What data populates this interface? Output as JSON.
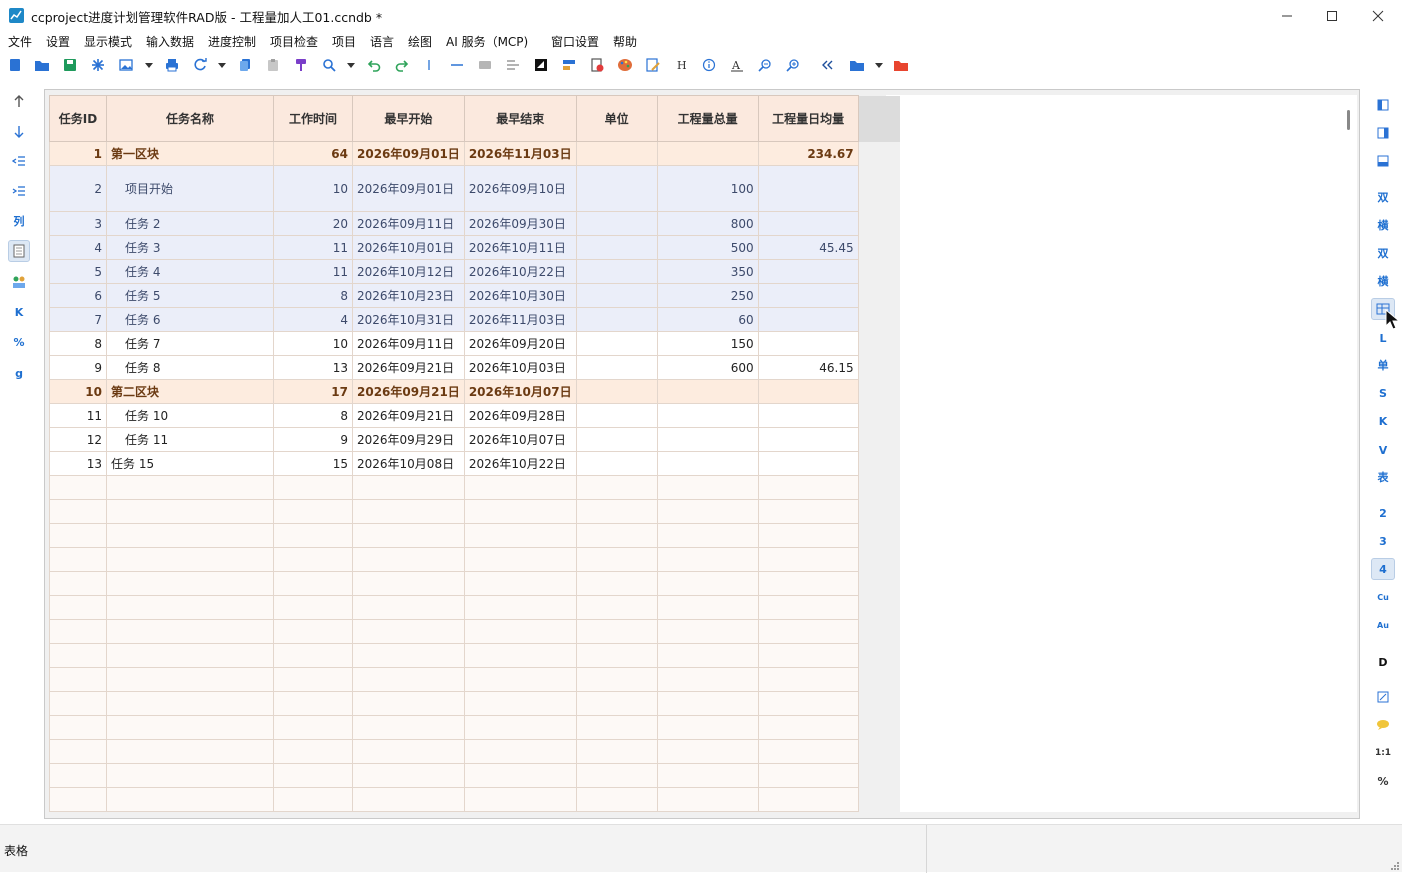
{
  "window": {
    "title": "ccproject进度计划管理软件RAD版 - 工程量加人工01.ccndb *"
  },
  "menu": [
    "文件",
    "设置",
    "显示模式",
    "输入数据",
    "进度控制",
    "项目检查",
    "项目",
    "语言",
    "绘图",
    "AI 服务（MCP)",
    "窗口设置",
    "帮助"
  ],
  "left_tools": {
    "col": "列",
    "k": "K",
    "percent": "%",
    "g": "g"
  },
  "right_tools": {
    "shuang": "双",
    "heng": "横",
    "shuang2": "双",
    "heng2": "横",
    "L": "L",
    "dan": "单",
    "S": "S",
    "K": "K",
    "V": "V",
    "biao": "表",
    "n2": "2",
    "n3": "3",
    "n4": "4",
    "cu": "Cu",
    "au": "Au",
    "D": "D",
    "ratio": "1:1",
    "percent": "%"
  },
  "grid": {
    "columns": [
      "任务ID",
      "任务名称",
      "工作时间",
      "最早开始",
      "最早结束",
      "单位",
      "工程量总量",
      "工程量日均量"
    ],
    "rows": [
      {
        "id": "1",
        "name": "第一区块",
        "dur": "64",
        "start": "2026年09月01日",
        "end": "2026年11月03日",
        "unit": "",
        "total": "",
        "daily": "234.67",
        "kind": "summary"
      },
      {
        "id": "2",
        "name": "项目开始",
        "dur": "10",
        "start": "2026年09月01日",
        "end": "2026年09月10日",
        "unit": "",
        "total": "100",
        "daily": "",
        "kind": "sel"
      },
      {
        "id": "3",
        "name": "任务 2",
        "dur": "20",
        "start": "2026年09月11日",
        "end": "2026年09月30日",
        "unit": "",
        "total": "800",
        "daily": "",
        "kind": "sel"
      },
      {
        "id": "4",
        "name": "任务 3",
        "dur": "11",
        "start": "2026年10月01日",
        "end": "2026年10月11日",
        "unit": "",
        "total": "500",
        "daily": "45.45",
        "kind": "sel"
      },
      {
        "id": "5",
        "name": "任务 4",
        "dur": "11",
        "start": "2026年10月12日",
        "end": "2026年10月22日",
        "unit": "",
        "total": "350",
        "daily": "",
        "kind": "sel"
      },
      {
        "id": "6",
        "name": "任务 5",
        "dur": "8",
        "start": "2026年10月23日",
        "end": "2026年10月30日",
        "unit": "",
        "total": "250",
        "daily": "",
        "kind": "sel"
      },
      {
        "id": "7",
        "name": "任务 6",
        "dur": "4",
        "start": "2026年10月31日",
        "end": "2026年11月03日",
        "unit": "",
        "total": "60",
        "daily": "",
        "kind": "sel"
      },
      {
        "id": "8",
        "name": "任务 7",
        "dur": "10",
        "start": "2026年09月11日",
        "end": "2026年09月20日",
        "unit": "",
        "total": "150",
        "daily": "",
        "kind": "normal"
      },
      {
        "id": "9",
        "name": "任务 8",
        "dur": "13",
        "start": "2026年09月21日",
        "end": "2026年10月03日",
        "unit": "",
        "total": "600",
        "daily": "46.15",
        "kind": "normal"
      },
      {
        "id": "10",
        "name": "第二区块",
        "dur": "17",
        "start": "2026年09月21日",
        "end": "2026年10月07日",
        "unit": "",
        "total": "",
        "daily": "",
        "kind": "summary"
      },
      {
        "id": "11",
        "name": "任务 10",
        "dur": "8",
        "start": "2026年09月21日",
        "end": "2026年09月28日",
        "unit": "",
        "total": "",
        "daily": "",
        "kind": "normal"
      },
      {
        "id": "12",
        "name": "任务 11",
        "dur": "9",
        "start": "2026年09月29日",
        "end": "2026年10月07日",
        "unit": "",
        "total": "",
        "daily": "",
        "kind": "normal"
      },
      {
        "id": "13",
        "name": "任务 15",
        "dur": "15",
        "start": "2026年10月08日",
        "end": "2026年10月22日",
        "unit": "",
        "total": "",
        "daily": "",
        "kind": "normal_noindent"
      }
    ]
  },
  "status": {
    "text": "表格"
  },
  "colors": {
    "accent": "#1e6fd0",
    "summary_bg": "#fdecdf",
    "selected_bg": "#ebeef9",
    "header_bg": "#fbe9de"
  }
}
